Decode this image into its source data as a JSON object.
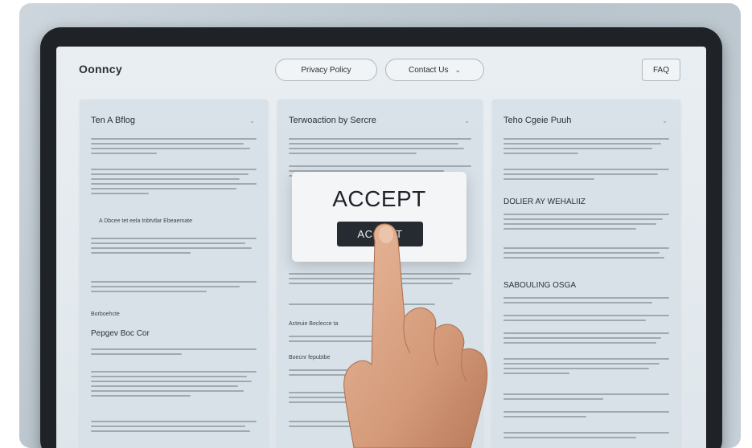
{
  "header": {
    "logo": "Oonncy",
    "nav_privacy": "Privacy Policy",
    "nav_contact": "Contact Us",
    "nav_faq": "FAQ"
  },
  "columns": [
    {
      "title": "Ten A Bflog",
      "label1": "A Dbcee tet eela tnbtvtlar Ebeaemate",
      "label2": "Borboehcte",
      "subtitle": "Pepgev Boc Cor"
    },
    {
      "title": "Terwoaction by Sercre",
      "label1": "Acteuie Beclecce ta",
      "label2": "Boecnr fepubtbe"
    },
    {
      "title": "Teho Cgeie Puuh",
      "subtitle1": "DOLIER AY WEHALIIZ",
      "subtitle2": "SABOULING OSGA"
    }
  ],
  "dialog": {
    "title": "ACCEPT",
    "button_label": "ACCEPT"
  },
  "icons": {
    "chevron": "chevron-down-icon"
  },
  "colors": {
    "button_bg": "#262b31",
    "screen_bg": "#e9eef2"
  }
}
